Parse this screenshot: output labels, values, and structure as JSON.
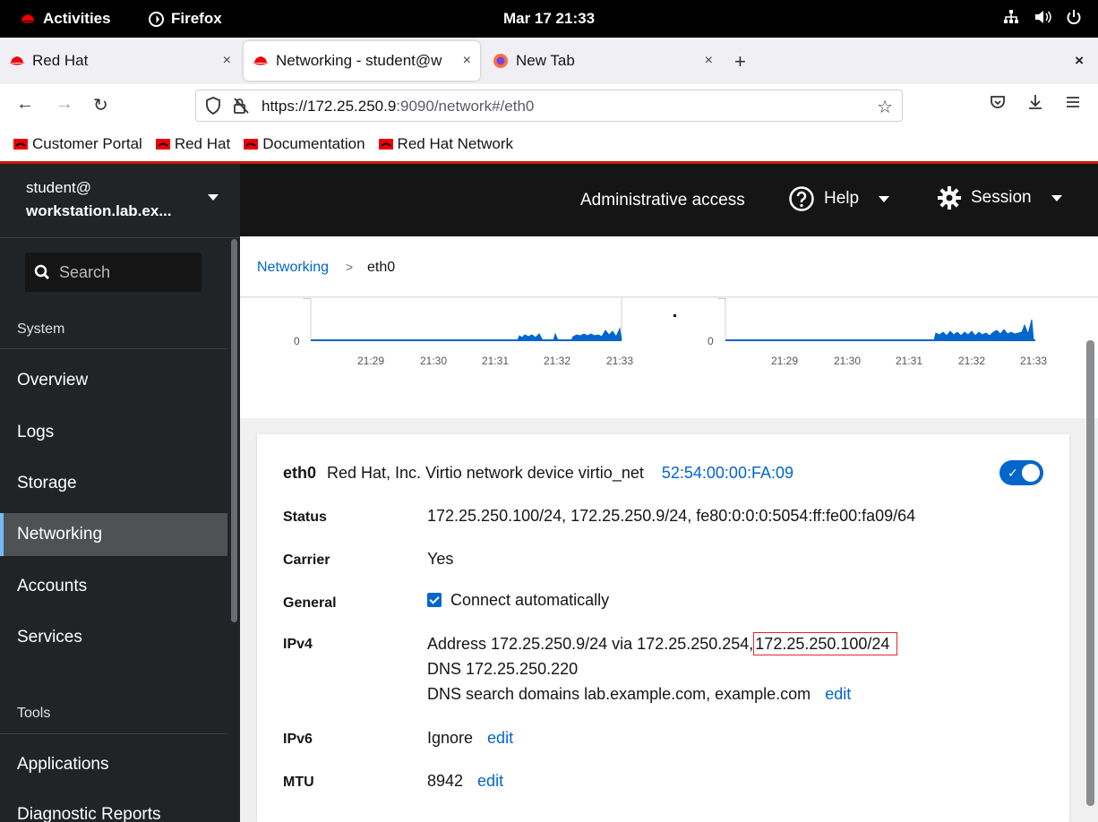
{
  "os": {
    "activities": "Activities",
    "app": "Firefox",
    "clock": "Mar 17  21:33"
  },
  "browser": {
    "tabs": [
      {
        "label": "Red Hat",
        "close": "×"
      },
      {
        "label": "Networking - student@w",
        "close": "×"
      },
      {
        "label": "New Tab",
        "close": "×"
      }
    ],
    "new_tab": "+",
    "window_close": "×",
    "url_host": "https://172.25.250.9",
    "url_rest": ":9090/network#/eth0",
    "bookmarks": [
      "Customer Portal",
      "Red Hat",
      "Documentation",
      "Red Hat Network"
    ]
  },
  "colors": {
    "accent": "#0066cc",
    "sidebar_bg": "#212427",
    "header_bg": "#151515",
    "redhat_red": "#ee0000",
    "highlight": "#e0282e"
  },
  "sidebar": {
    "user": "student@",
    "host": "workstation.lab.ex...",
    "search_placeholder": "Search",
    "group_system": "System",
    "items": [
      "Overview",
      "Logs",
      "Storage",
      "Networking",
      "Accounts",
      "Services"
    ],
    "group_tools": "Tools",
    "tools": [
      "Applications",
      "Diagnostic Reports"
    ]
  },
  "header": {
    "admin": "Administrative access",
    "help": "Help",
    "session": "Session"
  },
  "breadcrumb": {
    "parent": "Networking",
    "separator": ">",
    "current": "eth0"
  },
  "chart_data": [
    {
      "type": "area",
      "categories": [
        "21:29",
        "21:30",
        "21:31",
        "21:32",
        "21:33"
      ],
      "y_tick": "0",
      "x_ticks": [
        "21:29",
        "21:30",
        "21:31",
        "21:32",
        "21:33"
      ]
    },
    {
      "type": "area",
      "categories": [
        "21:29",
        "21:30",
        "21:31",
        "21:32",
        "21:33"
      ],
      "y_tick": "0",
      "x_ticks": [
        "21:29",
        "21:30",
        "21:31",
        "21:32",
        "21:33"
      ]
    }
  ],
  "interface": {
    "name": "eth0",
    "description": "Red Hat, Inc. Virtio network device virtio_net",
    "mac": "52:54:00:00:FA:09",
    "enabled": true,
    "rows": {
      "status_label": "Status",
      "status_value": "172.25.250.100/24, 172.25.250.9/24, fe80:0:0:0:5054:ff:fe00:fa09/64",
      "carrier_label": "Carrier",
      "carrier_value": "Yes",
      "general_label": "General",
      "general_value": "Connect automatically",
      "ipv4_label": "IPv4",
      "ipv4_address": "Address 172.25.250.9/24 via 172.25.250.254,",
      "ipv4_extra": "172.25.250.100/24",
      "ipv4_dns": "DNS 172.25.250.220",
      "ipv4_search": "DNS search domains lab.example.com, example.com",
      "ipv4_edit": "edit",
      "ipv6_label": "IPv6",
      "ipv6_value": "Ignore",
      "ipv6_edit": "edit",
      "mtu_label": "MTU",
      "mtu_value": "8942",
      "mtu_edit": "edit"
    }
  }
}
